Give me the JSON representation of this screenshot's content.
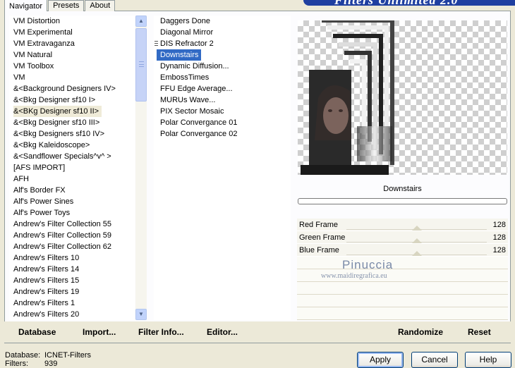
{
  "banner": {
    "title": "Filters Unlimited 2.0"
  },
  "tabs": [
    {
      "label": "Navigator"
    },
    {
      "label": "Presets"
    },
    {
      "label": "About"
    }
  ],
  "categories": {
    "selected": "&<BKg Designer sf10 II>",
    "items": [
      "VM Distortion",
      "VM Experimental",
      "VM Extravaganza",
      "VM Natural",
      "VM Toolbox",
      "VM",
      "&<Background Designers IV>",
      "&<Bkg Designer sf10 I>",
      "&<BKg Designer sf10 II>",
      "&<Bkg Designer sf10 III>",
      "&<Bkg Designers sf10 IV>",
      "&<Bkg Kaleidoscope>",
      "&<Sandflower Specials^v^ >",
      "[AFS IMPORT]",
      "AFH",
      "Alf's Border FX",
      "Alf's Power Sines",
      "Alf's Power Toys",
      "Andrew's Filter Collection 55",
      "Andrew's Filter Collection 59",
      "Andrew's Filter Collection 62",
      "Andrew's Filters 10",
      "Andrew's Filters 14",
      "Andrew's Filters 15",
      "Andrew's Filters 19",
      "Andrew's Filters 1",
      "Andrew's Filters 20"
    ]
  },
  "filters": {
    "selected": "Downstairs",
    "items": [
      "Daggers Done",
      "Diagonal Mirror",
      "DIS Refractor 2",
      "Downstairs",
      "Dynamic Diffusion...",
      "EmbossTimes",
      "FFU Edge Average...",
      "MURUs Wave...",
      "PIX Sector Mosaic",
      "Polar Convergance 01",
      "Polar Convergance 02"
    ]
  },
  "preview": {
    "filter_name": "Downstairs",
    "progress": 0
  },
  "sliders": [
    {
      "label": "Red Frame",
      "value": "128",
      "level": 0.5
    },
    {
      "label": "Green Frame",
      "value": "128",
      "level": 0.5
    },
    {
      "label": "Blue Frame",
      "value": "128",
      "level": 0.5
    }
  ],
  "watermark": {
    "name": "Pinuccia",
    "url": "www.maidiregrafica.eu"
  },
  "commands": {
    "database": "Database",
    "import": "Import...",
    "filter_info": "Filter Info...",
    "editor": "Editor...",
    "randomize": "Randomize",
    "reset": "Reset"
  },
  "status": {
    "database_label": "Database:",
    "database_value": "ICNET-Filters",
    "filters_label": "Filters:",
    "filters_value": "939"
  },
  "buttons": {
    "apply": "Apply",
    "cancel": "Cancel",
    "help": "Help"
  },
  "colors": {
    "selection": "#316ac5",
    "accent": "#1f3fa0"
  }
}
